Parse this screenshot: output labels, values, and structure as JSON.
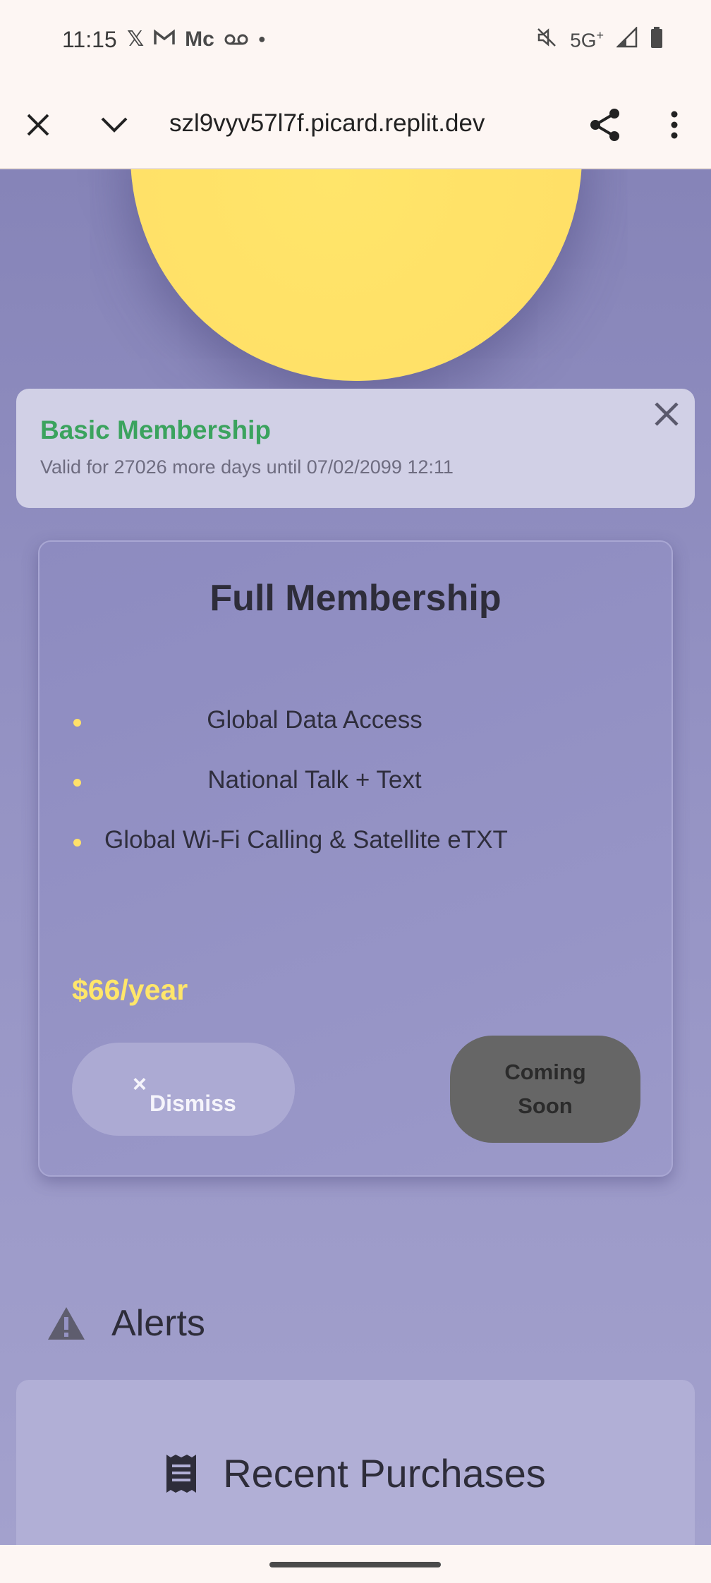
{
  "status_bar": {
    "time": "11:15",
    "left_icons": [
      "x-icon",
      "gmail-icon",
      "mc-icon",
      "voicemail-icon",
      "dot-icon"
    ],
    "mc_text": "Mc",
    "network": "5G",
    "network_sup": "+"
  },
  "browser": {
    "url": "szl9vyv57l7f.picard.replit.dev"
  },
  "basic_membership": {
    "title": "Basic Membership",
    "subtitle": "Valid for 27026 more days until 07/02/2099 12:11"
  },
  "full_membership": {
    "title": "Full Membership",
    "features": [
      "Global Data Access",
      "National Talk + Text",
      "Global Wi-Fi Calling & Satellite eTXT"
    ],
    "price": "$66/year",
    "dismiss_icon": "×",
    "dismiss_label": "Dismiss",
    "coming_soon_label": "Coming Soon"
  },
  "alerts": {
    "label": "Alerts",
    "icon": "warning-icon"
  },
  "recent_purchases": {
    "label": "Recent Purchases",
    "icon": "receipt-icon"
  },
  "colors": {
    "accent_green": "#3ba35e",
    "accent_yellow": "#ffe66a",
    "background_purple": "#9593c4"
  }
}
